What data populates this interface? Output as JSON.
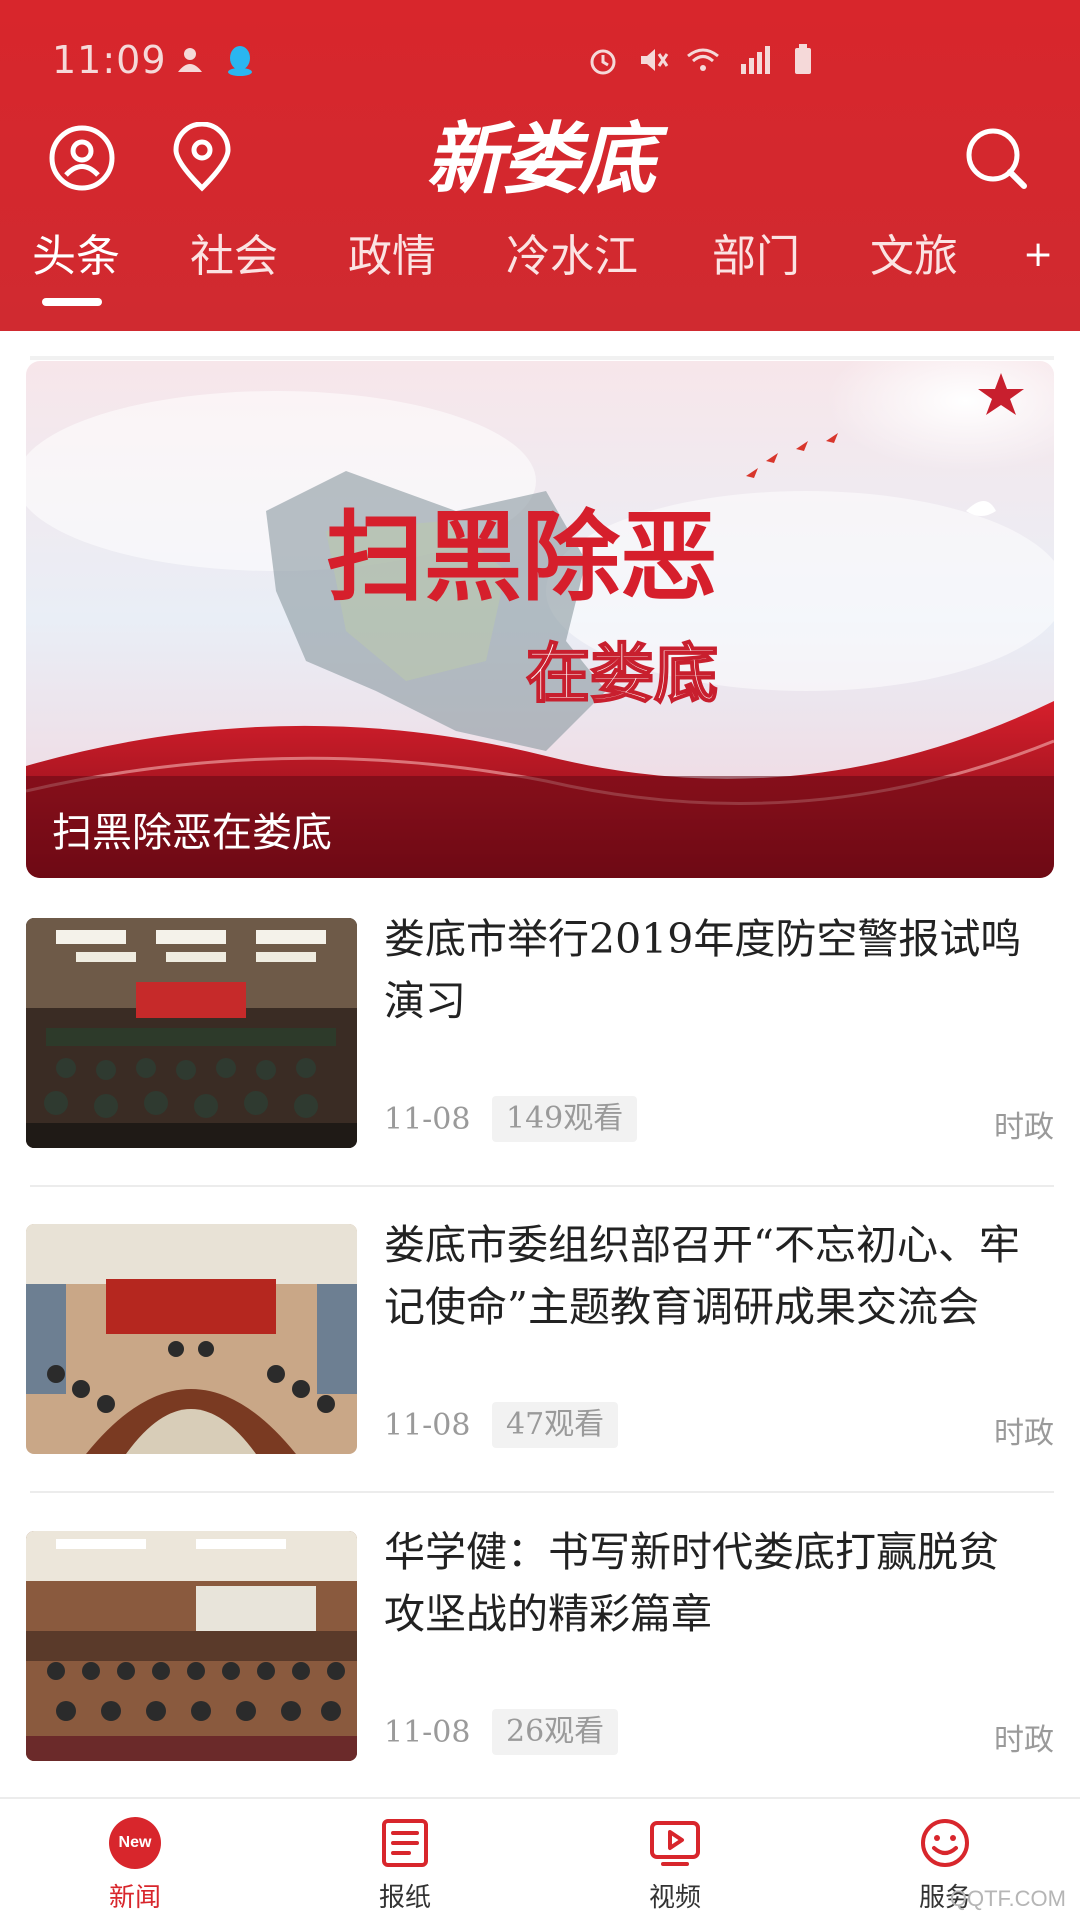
{
  "status_bar": {
    "time": "11:09",
    "left_icons": [
      "notification-icon",
      "qq-icon"
    ],
    "right_icons": [
      "alarm-icon",
      "mute-icon",
      "wifi-icon",
      "signal-4g-icon",
      "battery-icon"
    ]
  },
  "header": {
    "logo_text": "新娄底",
    "icons": [
      "user-icon",
      "location-icon",
      "search-icon"
    ],
    "tabs": [
      {
        "label": "头条",
        "active": true
      },
      {
        "label": "社会"
      },
      {
        "label": "政情"
      },
      {
        "label": "冷水江"
      },
      {
        "label": "部门"
      },
      {
        "label": "文旅"
      }
    ],
    "more_label": "+"
  },
  "banner": {
    "title_art": "扫黑除恶",
    "subtitle_art": "在娄底",
    "caption": "扫黑除恶在娄底"
  },
  "news": [
    {
      "title": "娄底市举行2019年度防空警报试鸣演习",
      "date": "11-08",
      "views": "149观看",
      "category": "时政"
    },
    {
      "title": "娄底市委组织部召开“不忘初心、牢记使命”主题教育调研成果交流会",
      "date": "11-08",
      "views": "47观看",
      "category": "时政"
    },
    {
      "title": "华学健：书写新时代娄底打赢脱贫攻坚战的精彩篇章",
      "date": "11-08",
      "views": "26观看",
      "category": "时政"
    }
  ],
  "bottom_nav": [
    {
      "label": "新闻",
      "icon": "news-icon",
      "badge": "New",
      "active": true
    },
    {
      "label": "报纸",
      "icon": "newspaper-icon"
    },
    {
      "label": "视频",
      "icon": "video-icon"
    },
    {
      "label": "服务",
      "icon": "smile-icon"
    }
  ],
  "colors": {
    "brand_red": "#d8262c",
    "text_dark": "#222222",
    "text_muted": "#9a9a9a"
  },
  "watermark": "QQTF.COM"
}
